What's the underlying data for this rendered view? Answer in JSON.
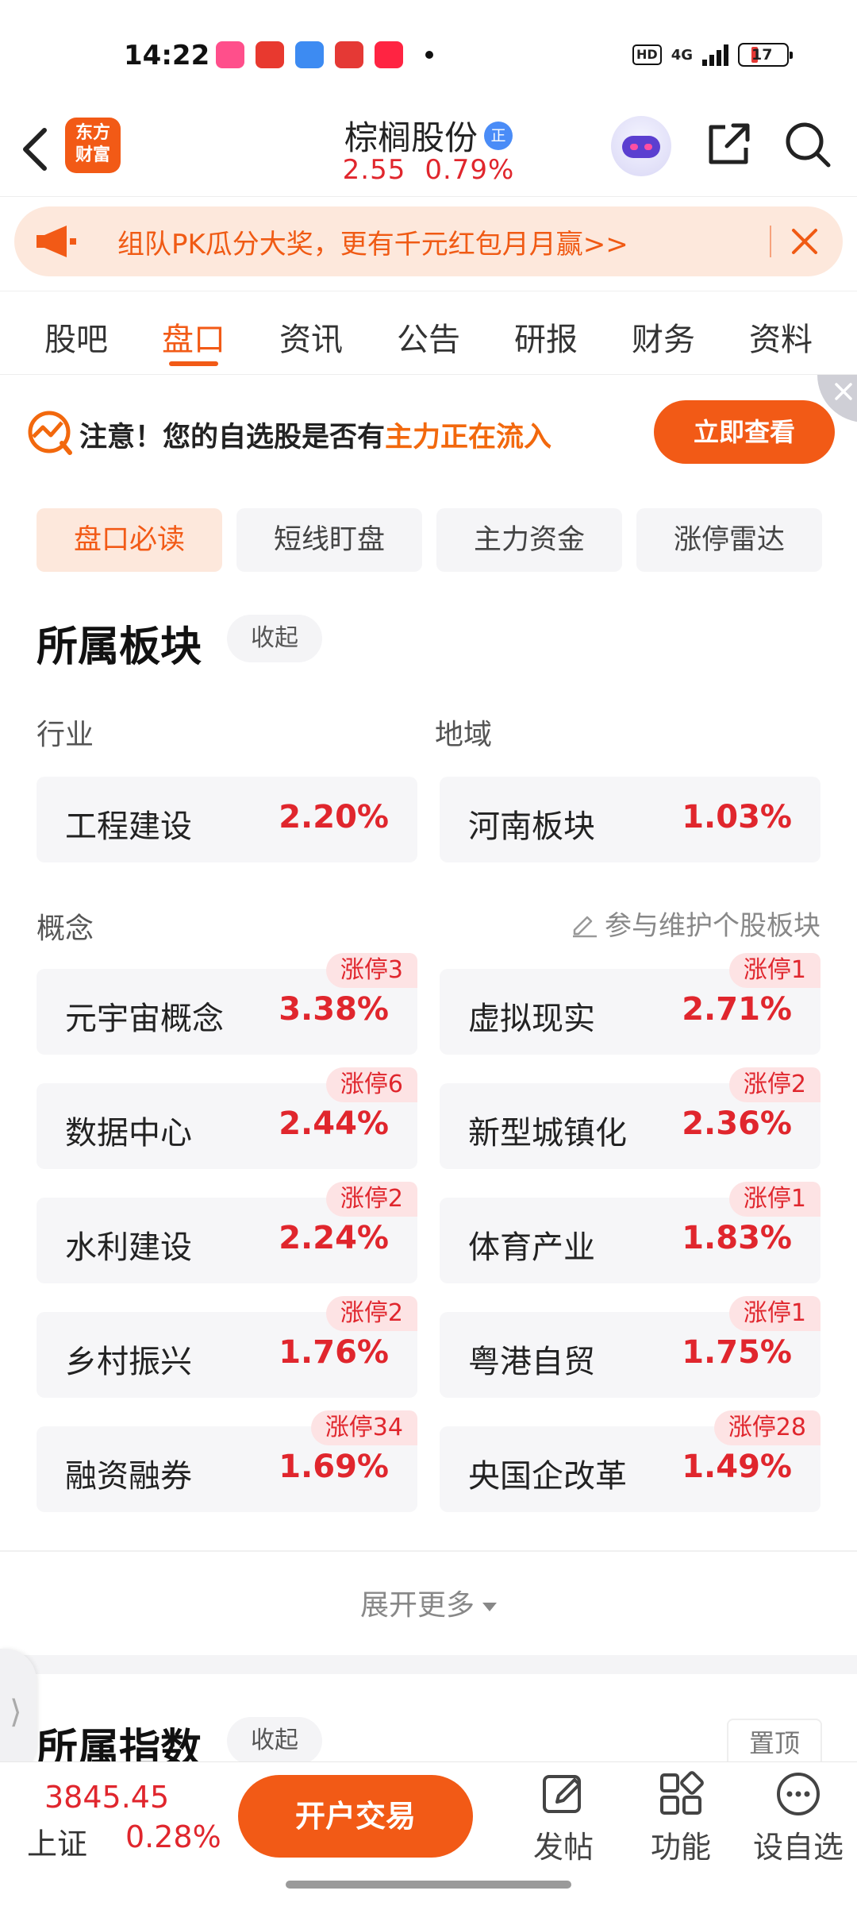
{
  "status_bar": {
    "time": "14:22",
    "app_icons": [
      "手机淘宝",
      "头条",
      "天气",
      "东方财富",
      "小红书"
    ],
    "hd": "HD",
    "network": "4G",
    "battery": "17"
  },
  "header": {
    "logo_line1": "东方",
    "logo_line2": "财富",
    "stock_name": "棕榈股份",
    "badge": "正",
    "price": "2.55",
    "change_pct": "0.79%"
  },
  "banner": {
    "text": "组队PK瓜分大奖，更有千元红包月月赢>>"
  },
  "tabs": [
    {
      "label": "股吧",
      "active": false
    },
    {
      "label": "盘口",
      "active": true
    },
    {
      "label": "资讯",
      "active": false
    },
    {
      "label": "公告",
      "active": false
    },
    {
      "label": "研报",
      "active": false
    },
    {
      "label": "财务",
      "active": false
    },
    {
      "label": "资料",
      "active": false
    }
  ],
  "notice": {
    "prefix": "注意！您的自选股是否有",
    "highlight": "主力正在流入",
    "cta": "立即查看"
  },
  "subtabs": [
    {
      "label": "盘口必读",
      "active": true
    },
    {
      "label": "短线盯盘",
      "active": false
    },
    {
      "label": "主力资金",
      "active": false
    },
    {
      "label": "涨停雷达",
      "active": false
    }
  ],
  "sector": {
    "title": "所属板块",
    "collapse": "收起",
    "industry_label": "行业",
    "region_label": "地域",
    "industry": {
      "name": "工程建设",
      "pct": "2.20%"
    },
    "region": {
      "name": "河南板块",
      "pct": "1.03%"
    },
    "concept_label": "概念",
    "maintain_link": "参与维护个股板块",
    "concepts": [
      {
        "name": "元宇宙概念",
        "pct": "3.38%",
        "badge": "涨停3"
      },
      {
        "name": "虚拟现实",
        "pct": "2.71%",
        "badge": "涨停1"
      },
      {
        "name": "数据中心",
        "pct": "2.44%",
        "badge": "涨停6"
      },
      {
        "name": "新型城镇化",
        "pct": "2.36%",
        "badge": "涨停2"
      },
      {
        "name": "水利建设",
        "pct": "2.24%",
        "badge": "涨停2"
      },
      {
        "name": "体育产业",
        "pct": "1.83%",
        "badge": "涨停1"
      },
      {
        "name": "乡村振兴",
        "pct": "1.76%",
        "badge": "涨停2"
      },
      {
        "name": "粤港自贸",
        "pct": "1.75%",
        "badge": "涨停1"
      },
      {
        "name": "融资融券",
        "pct": "1.69%",
        "badge": "涨停34"
      },
      {
        "name": "央国企改革",
        "pct": "1.49%",
        "badge": "涨停28"
      }
    ],
    "expand_more": "展开更多"
  },
  "index_section": {
    "title": "所属指数",
    "collapse": "收起",
    "pin_top": "置顶"
  },
  "bottom_bar": {
    "index_value": "3845.45",
    "index_name": "上证",
    "index_pct": "0.28%",
    "trade_button": "开户交易",
    "post": "发帖",
    "functions": "功能",
    "add_watchlist": "设自选"
  },
  "colors": {
    "accent": "#f25a16",
    "up_red": "#e0262d",
    "banner_bg": "#fde8dc"
  }
}
